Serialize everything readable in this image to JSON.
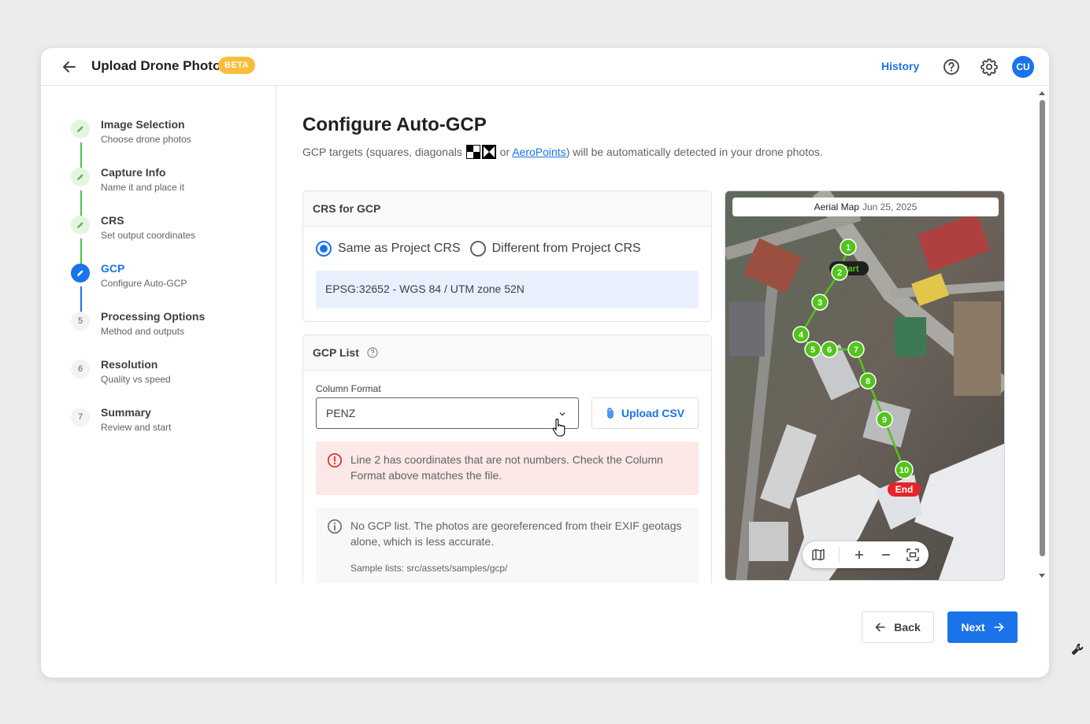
{
  "header": {
    "title": "Upload Drone Photos",
    "badge": "BETA",
    "history_label": "History",
    "avatar_initials": "CU"
  },
  "steps": [
    {
      "label": "Image Selection",
      "sub": "Choose drone photos",
      "status": "done"
    },
    {
      "label": "Capture Info",
      "sub": "Name it and place it",
      "status": "done"
    },
    {
      "label": "CRS",
      "sub": "Set output coordinates",
      "status": "done"
    },
    {
      "label": "GCP",
      "sub": "Configure Auto-GCP",
      "status": "active"
    },
    {
      "label": "Processing Options",
      "sub": "Method and outputs",
      "status": "todo",
      "number": "5"
    },
    {
      "label": "Resolution",
      "sub": "Quality vs speed",
      "status": "todo",
      "number": "6"
    },
    {
      "label": "Summary",
      "sub": "Review and start",
      "status": "todo",
      "number": "7"
    }
  ],
  "main": {
    "heading": "Configure Auto-GCP",
    "desc_prefix": "GCP targets (squares, diagonals",
    "desc_or": "or",
    "desc_link": "AeroPoints",
    "desc_suffix": ") will be automatically detected in your drone photos."
  },
  "crs_card": {
    "title": "CRS for GCP",
    "option_same": "Same as Project CRS",
    "option_different": "Different from Project CRS",
    "selected": "same",
    "crs_value": "EPSG:32652 - WGS 84 / UTM zone 52N"
  },
  "gcp_card": {
    "title": "GCP List",
    "column_format_label": "Column Format",
    "column_format_value": "PENZ",
    "upload_label": "Upload CSV",
    "error_text": "Line 2 has coordinates that are not numbers. Check the Column Format above matches the file.",
    "info_text": "No GCP list. The photos are georeferenced from their EXIF geotags alone, which is less accurate.",
    "sample_text": "Sample lists: src/assets/samples/gcp/"
  },
  "map": {
    "label": "Aerial Map",
    "date": "Jun 25, 2025",
    "start_label": "Start",
    "end_label": "End",
    "markers": [
      "1",
      "2",
      "3",
      "4",
      "5",
      "6",
      "7",
      "8",
      "9",
      "10"
    ],
    "marker_color": "#52c41a",
    "end_color": "#e8232a"
  },
  "footer": {
    "back_label": "Back",
    "next_label": "Next"
  },
  "colors": {
    "accent": "#1a73e8",
    "success": "#4cc24a",
    "badge": "#f9be3c",
    "error_bg": "#fce8e6",
    "crs_bg": "#e8f0fe"
  }
}
